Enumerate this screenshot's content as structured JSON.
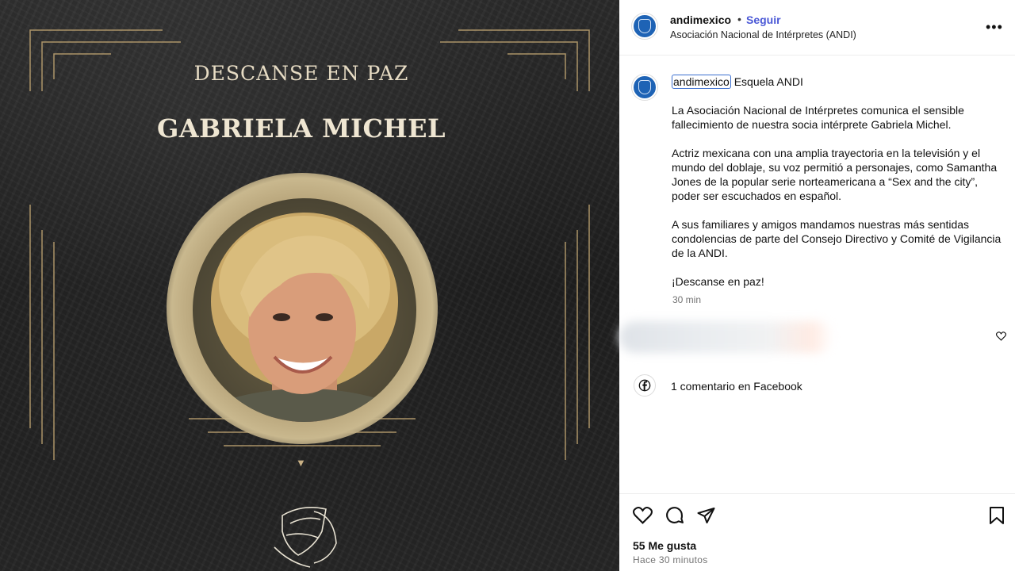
{
  "image_panel": {
    "subtitle": "DESCANSE EN PAZ",
    "name": "GABRIELA MICHEL"
  },
  "header": {
    "username": "andimexico",
    "separator": "•",
    "follow_label": "Seguir",
    "subtitle": "Asociación Nacional de Intérpretes (ANDI)",
    "more_icon": "more-icon"
  },
  "caption": {
    "username": "andimexico",
    "title": " Esquela ANDI",
    "paragraphs": [
      "La Asociación Nacional de Intérpretes comunica el sensible fallecimiento de nuestra socia intérprete Gabriela Michel.",
      "Actriz mexicana con una amplia trayectoria en la televisión y el mundo del doblaje, su voz permitió a personajes, como Samantha Jones de la popular serie norteamericana a “Sex and the city”, poder ser escuchados en español.",
      "A sus familiares y amigos mandamos nuestras más sentidas condolencias de parte del Consejo Directivo y Comité de Vigilancia de la ANDI.",
      "¡Descanse en paz!"
    ],
    "time": "30 min"
  },
  "facebook": {
    "label": "1 comentario en Facebook"
  },
  "footer": {
    "likes": "55 Me gusta",
    "time_ago": "Hace 30 minutos"
  },
  "colors": {
    "follow": "#4a58d6",
    "gold": "#b99f6f",
    "avatar": "#1e63b5"
  }
}
